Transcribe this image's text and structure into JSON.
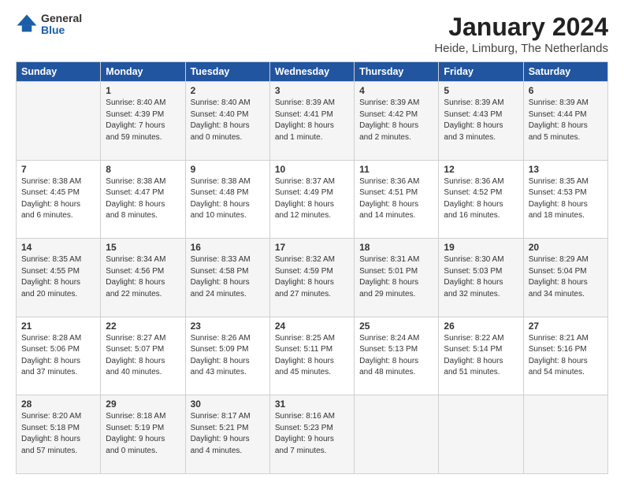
{
  "header": {
    "logo_general": "General",
    "logo_blue": "Blue",
    "title": "January 2024",
    "location": "Heide, Limburg, The Netherlands"
  },
  "days_of_week": [
    "Sunday",
    "Monday",
    "Tuesday",
    "Wednesday",
    "Thursday",
    "Friday",
    "Saturday"
  ],
  "weeks": [
    [
      {
        "num": "",
        "sunrise": "",
        "sunset": "",
        "daylight": "",
        "empty": true
      },
      {
        "num": "1",
        "sunrise": "Sunrise: 8:40 AM",
        "sunset": "Sunset: 4:39 PM",
        "daylight": "Daylight: 7 hours and 59 minutes.",
        "empty": false
      },
      {
        "num": "2",
        "sunrise": "Sunrise: 8:40 AM",
        "sunset": "Sunset: 4:40 PM",
        "daylight": "Daylight: 8 hours and 0 minutes.",
        "empty": false
      },
      {
        "num": "3",
        "sunrise": "Sunrise: 8:39 AM",
        "sunset": "Sunset: 4:41 PM",
        "daylight": "Daylight: 8 hours and 1 minute.",
        "empty": false
      },
      {
        "num": "4",
        "sunrise": "Sunrise: 8:39 AM",
        "sunset": "Sunset: 4:42 PM",
        "daylight": "Daylight: 8 hours and 2 minutes.",
        "empty": false
      },
      {
        "num": "5",
        "sunrise": "Sunrise: 8:39 AM",
        "sunset": "Sunset: 4:43 PM",
        "daylight": "Daylight: 8 hours and 3 minutes.",
        "empty": false
      },
      {
        "num": "6",
        "sunrise": "Sunrise: 8:39 AM",
        "sunset": "Sunset: 4:44 PM",
        "daylight": "Daylight: 8 hours and 5 minutes.",
        "empty": false
      }
    ],
    [
      {
        "num": "7",
        "sunrise": "Sunrise: 8:38 AM",
        "sunset": "Sunset: 4:45 PM",
        "daylight": "Daylight: 8 hours and 6 minutes.",
        "empty": false
      },
      {
        "num": "8",
        "sunrise": "Sunrise: 8:38 AM",
        "sunset": "Sunset: 4:47 PM",
        "daylight": "Daylight: 8 hours and 8 minutes.",
        "empty": false
      },
      {
        "num": "9",
        "sunrise": "Sunrise: 8:38 AM",
        "sunset": "Sunset: 4:48 PM",
        "daylight": "Daylight: 8 hours and 10 minutes.",
        "empty": false
      },
      {
        "num": "10",
        "sunrise": "Sunrise: 8:37 AM",
        "sunset": "Sunset: 4:49 PM",
        "daylight": "Daylight: 8 hours and 12 minutes.",
        "empty": false
      },
      {
        "num": "11",
        "sunrise": "Sunrise: 8:36 AM",
        "sunset": "Sunset: 4:51 PM",
        "daylight": "Daylight: 8 hours and 14 minutes.",
        "empty": false
      },
      {
        "num": "12",
        "sunrise": "Sunrise: 8:36 AM",
        "sunset": "Sunset: 4:52 PM",
        "daylight": "Daylight: 8 hours and 16 minutes.",
        "empty": false
      },
      {
        "num": "13",
        "sunrise": "Sunrise: 8:35 AM",
        "sunset": "Sunset: 4:53 PM",
        "daylight": "Daylight: 8 hours and 18 minutes.",
        "empty": false
      }
    ],
    [
      {
        "num": "14",
        "sunrise": "Sunrise: 8:35 AM",
        "sunset": "Sunset: 4:55 PM",
        "daylight": "Daylight: 8 hours and 20 minutes.",
        "empty": false
      },
      {
        "num": "15",
        "sunrise": "Sunrise: 8:34 AM",
        "sunset": "Sunset: 4:56 PM",
        "daylight": "Daylight: 8 hours and 22 minutes.",
        "empty": false
      },
      {
        "num": "16",
        "sunrise": "Sunrise: 8:33 AM",
        "sunset": "Sunset: 4:58 PM",
        "daylight": "Daylight: 8 hours and 24 minutes.",
        "empty": false
      },
      {
        "num": "17",
        "sunrise": "Sunrise: 8:32 AM",
        "sunset": "Sunset: 4:59 PM",
        "daylight": "Daylight: 8 hours and 27 minutes.",
        "empty": false
      },
      {
        "num": "18",
        "sunrise": "Sunrise: 8:31 AM",
        "sunset": "Sunset: 5:01 PM",
        "daylight": "Daylight: 8 hours and 29 minutes.",
        "empty": false
      },
      {
        "num": "19",
        "sunrise": "Sunrise: 8:30 AM",
        "sunset": "Sunset: 5:03 PM",
        "daylight": "Daylight: 8 hours and 32 minutes.",
        "empty": false
      },
      {
        "num": "20",
        "sunrise": "Sunrise: 8:29 AM",
        "sunset": "Sunset: 5:04 PM",
        "daylight": "Daylight: 8 hours and 34 minutes.",
        "empty": false
      }
    ],
    [
      {
        "num": "21",
        "sunrise": "Sunrise: 8:28 AM",
        "sunset": "Sunset: 5:06 PM",
        "daylight": "Daylight: 8 hours and 37 minutes.",
        "empty": false
      },
      {
        "num": "22",
        "sunrise": "Sunrise: 8:27 AM",
        "sunset": "Sunset: 5:07 PM",
        "daylight": "Daylight: 8 hours and 40 minutes.",
        "empty": false
      },
      {
        "num": "23",
        "sunrise": "Sunrise: 8:26 AM",
        "sunset": "Sunset: 5:09 PM",
        "daylight": "Daylight: 8 hours and 43 minutes.",
        "empty": false
      },
      {
        "num": "24",
        "sunrise": "Sunrise: 8:25 AM",
        "sunset": "Sunset: 5:11 PM",
        "daylight": "Daylight: 8 hours and 45 minutes.",
        "empty": false
      },
      {
        "num": "25",
        "sunrise": "Sunrise: 8:24 AM",
        "sunset": "Sunset: 5:13 PM",
        "daylight": "Daylight: 8 hours and 48 minutes.",
        "empty": false
      },
      {
        "num": "26",
        "sunrise": "Sunrise: 8:22 AM",
        "sunset": "Sunset: 5:14 PM",
        "daylight": "Daylight: 8 hours and 51 minutes.",
        "empty": false
      },
      {
        "num": "27",
        "sunrise": "Sunrise: 8:21 AM",
        "sunset": "Sunset: 5:16 PM",
        "daylight": "Daylight: 8 hours and 54 minutes.",
        "empty": false
      }
    ],
    [
      {
        "num": "28",
        "sunrise": "Sunrise: 8:20 AM",
        "sunset": "Sunset: 5:18 PM",
        "daylight": "Daylight: 8 hours and 57 minutes.",
        "empty": false
      },
      {
        "num": "29",
        "sunrise": "Sunrise: 8:18 AM",
        "sunset": "Sunset: 5:19 PM",
        "daylight": "Daylight: 9 hours and 0 minutes.",
        "empty": false
      },
      {
        "num": "30",
        "sunrise": "Sunrise: 8:17 AM",
        "sunset": "Sunset: 5:21 PM",
        "daylight": "Daylight: 9 hours and 4 minutes.",
        "empty": false
      },
      {
        "num": "31",
        "sunrise": "Sunrise: 8:16 AM",
        "sunset": "Sunset: 5:23 PM",
        "daylight": "Daylight: 9 hours and 7 minutes.",
        "empty": false
      },
      {
        "num": "",
        "sunrise": "",
        "sunset": "",
        "daylight": "",
        "empty": true
      },
      {
        "num": "",
        "sunrise": "",
        "sunset": "",
        "daylight": "",
        "empty": true
      },
      {
        "num": "",
        "sunrise": "",
        "sunset": "",
        "daylight": "",
        "empty": true
      }
    ]
  ]
}
